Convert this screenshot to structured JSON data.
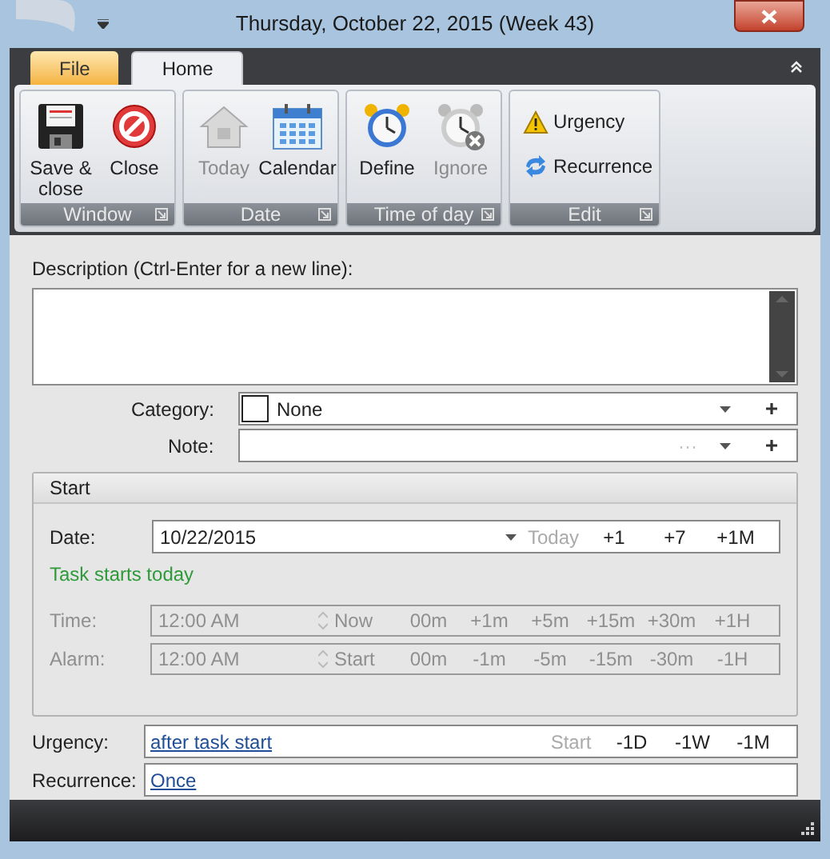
{
  "window": {
    "title": "Thursday, October 22, 2015 (Week 43)"
  },
  "tabs": [
    {
      "label": "File",
      "selected": false,
      "kind": "file"
    },
    {
      "label": "Home",
      "selected": true,
      "kind": "normal"
    }
  ],
  "ribbon_groups": [
    {
      "label": "Window",
      "buttons": [
        {
          "label": "Save & close",
          "disabled": false
        },
        {
          "label": "Close",
          "disabled": false
        }
      ],
      "kind": "large"
    },
    {
      "label": "Date",
      "buttons": [
        {
          "label": "Today",
          "disabled": true
        },
        {
          "label": "Calendar",
          "disabled": false
        }
      ],
      "kind": "large"
    },
    {
      "label": "Time of day",
      "buttons": [
        {
          "label": "Define",
          "disabled": false
        },
        {
          "label": "Ignore",
          "disabled": true
        }
      ],
      "kind": "large"
    },
    {
      "label": "Edit",
      "buttons": [
        {
          "label": "Urgency",
          "disabled": false
        },
        {
          "label": "Recurrence",
          "disabled": false
        }
      ],
      "kind": "small"
    }
  ],
  "description": {
    "label": "Description (Ctrl-Enter for a new line):"
  },
  "category": {
    "label": "Category:",
    "value": "None"
  },
  "note": {
    "label": "Note:",
    "ellipsis": "···"
  },
  "start": {
    "title": "Start",
    "date": {
      "label": "Date:",
      "value": "10/22/2015",
      "buttons": [
        {
          "label": "Today",
          "disabled": true
        },
        {
          "label": "+1",
          "disabled": false
        },
        {
          "label": "+7",
          "disabled": false
        },
        {
          "label": "+1M",
          "disabled": false
        }
      ]
    },
    "status": "Task starts today",
    "time": {
      "label": "Time:",
      "value": "12:00 AM",
      "disabled": true,
      "buttons": [
        "Now",
        "00m",
        "+1m",
        "+5m",
        "+15m",
        "+30m",
        "+1H"
      ]
    },
    "alarm": {
      "label": "Alarm:",
      "value": "12:00 AM",
      "disabled": true,
      "buttons": [
        "Start",
        "00m",
        "-1m",
        "-5m",
        "-15m",
        "-30m",
        "-1H"
      ]
    }
  },
  "urgency": {
    "label": "Urgency:",
    "link": "after task start",
    "buttons": [
      {
        "label": "Start",
        "disabled": true
      },
      {
        "label": "-1D",
        "disabled": false
      },
      {
        "label": "-1W",
        "disabled": false
      },
      {
        "label": "-1M",
        "disabled": false
      }
    ]
  },
  "recurrence": {
    "label": "Recurrence:",
    "link": "Once"
  }
}
